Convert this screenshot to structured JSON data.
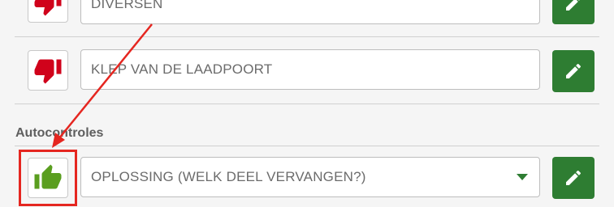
{
  "rows": [
    {
      "status_icon": "thumb-down-icon",
      "value": "DIVERSEN",
      "edit_icon": "pencil-icon"
    },
    {
      "status_icon": "thumb-down-icon",
      "value": "KLEP VAN DE LAADPOORT",
      "edit_icon": "pencil-icon"
    }
  ],
  "section": {
    "title": "Autocontroles",
    "row": {
      "status_icon": "thumb-up-icon",
      "value": "OPLOSSING (WELK DEEL VERVANGEN?)",
      "dropdown_icon": "caret-down-icon",
      "edit_icon": "pencil-icon"
    }
  },
  "annotation": {
    "color": "#e52620",
    "type": "arrow-and-box"
  },
  "colors": {
    "thumb_down": "#d0021b",
    "thumb_up": "#5a9e1f",
    "edit_button": "#2e7d32"
  }
}
